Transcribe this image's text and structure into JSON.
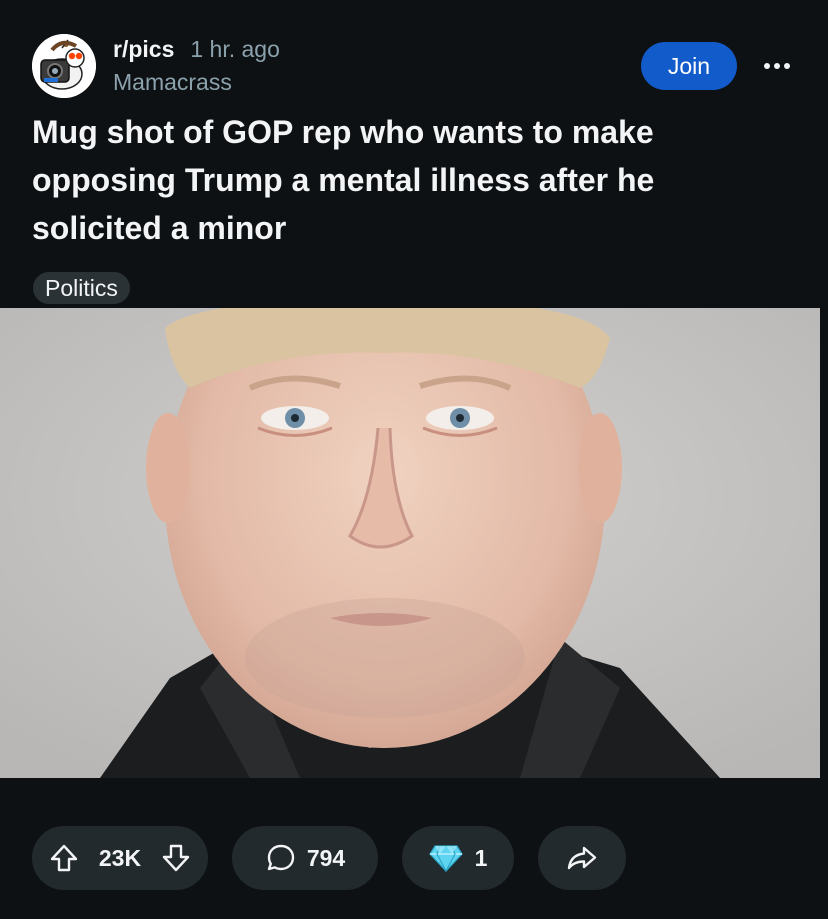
{
  "post": {
    "subreddit": "r/pics",
    "time_ago": "1 hr. ago",
    "author": "Mamacrass",
    "join_label": "Join",
    "title": "Mug shot of GOP rep who wants to make opposing Trump a mental illness after he solicited a minor",
    "flair": "Politics"
  },
  "actions": {
    "upvotes": "23K",
    "comments": "794",
    "awards": "1"
  },
  "icons": {
    "avatar": "reddit-snoo-camera-avatar",
    "more": "more-horizontal-icon",
    "upvote": "arrow-up-icon",
    "downvote": "arrow-down-icon",
    "comment": "speech-bubble-icon",
    "award": "diamond-icon",
    "share": "share-arrow-icon"
  },
  "colors": {
    "background": "#0e1113",
    "join_button": "#115bca",
    "pill": "#222a2e",
    "muted_text": "#8ba2ad",
    "award_diamond": "#5fd4f0"
  }
}
